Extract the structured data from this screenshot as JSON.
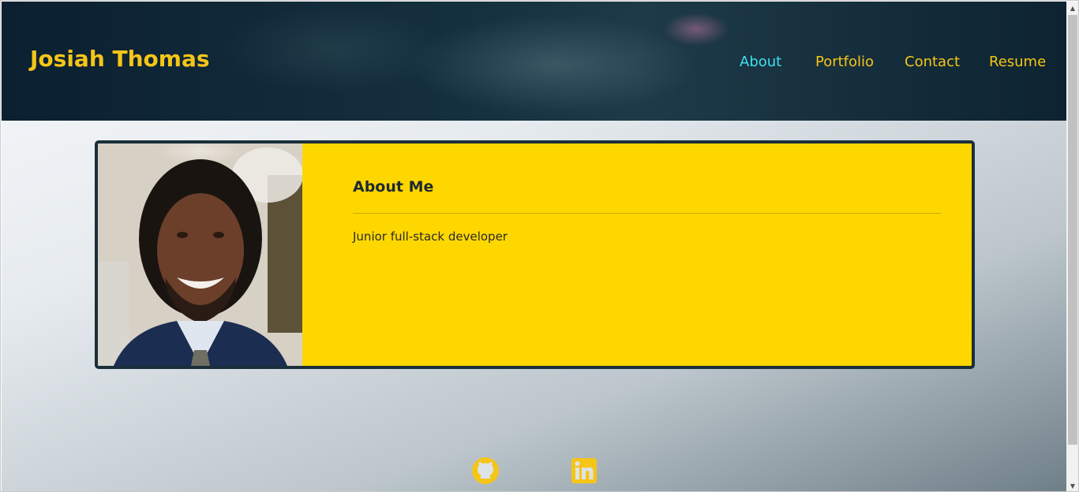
{
  "header": {
    "brand": "Josiah Thomas",
    "nav": [
      {
        "label": "About",
        "active": true
      },
      {
        "label": "Portfolio",
        "active": false
      },
      {
        "label": "Contact",
        "active": false
      },
      {
        "label": "Resume",
        "active": false
      }
    ]
  },
  "about": {
    "title": "About Me",
    "text": "Junior full-stack developer"
  },
  "social": [
    {
      "icon": "github-icon"
    },
    {
      "icon": "linkedin-icon"
    }
  ],
  "colors": {
    "accent": "#f5c518",
    "active_nav": "#3fe0f0",
    "card_bg": "#ffd700",
    "header_bg": "#0b2030"
  }
}
